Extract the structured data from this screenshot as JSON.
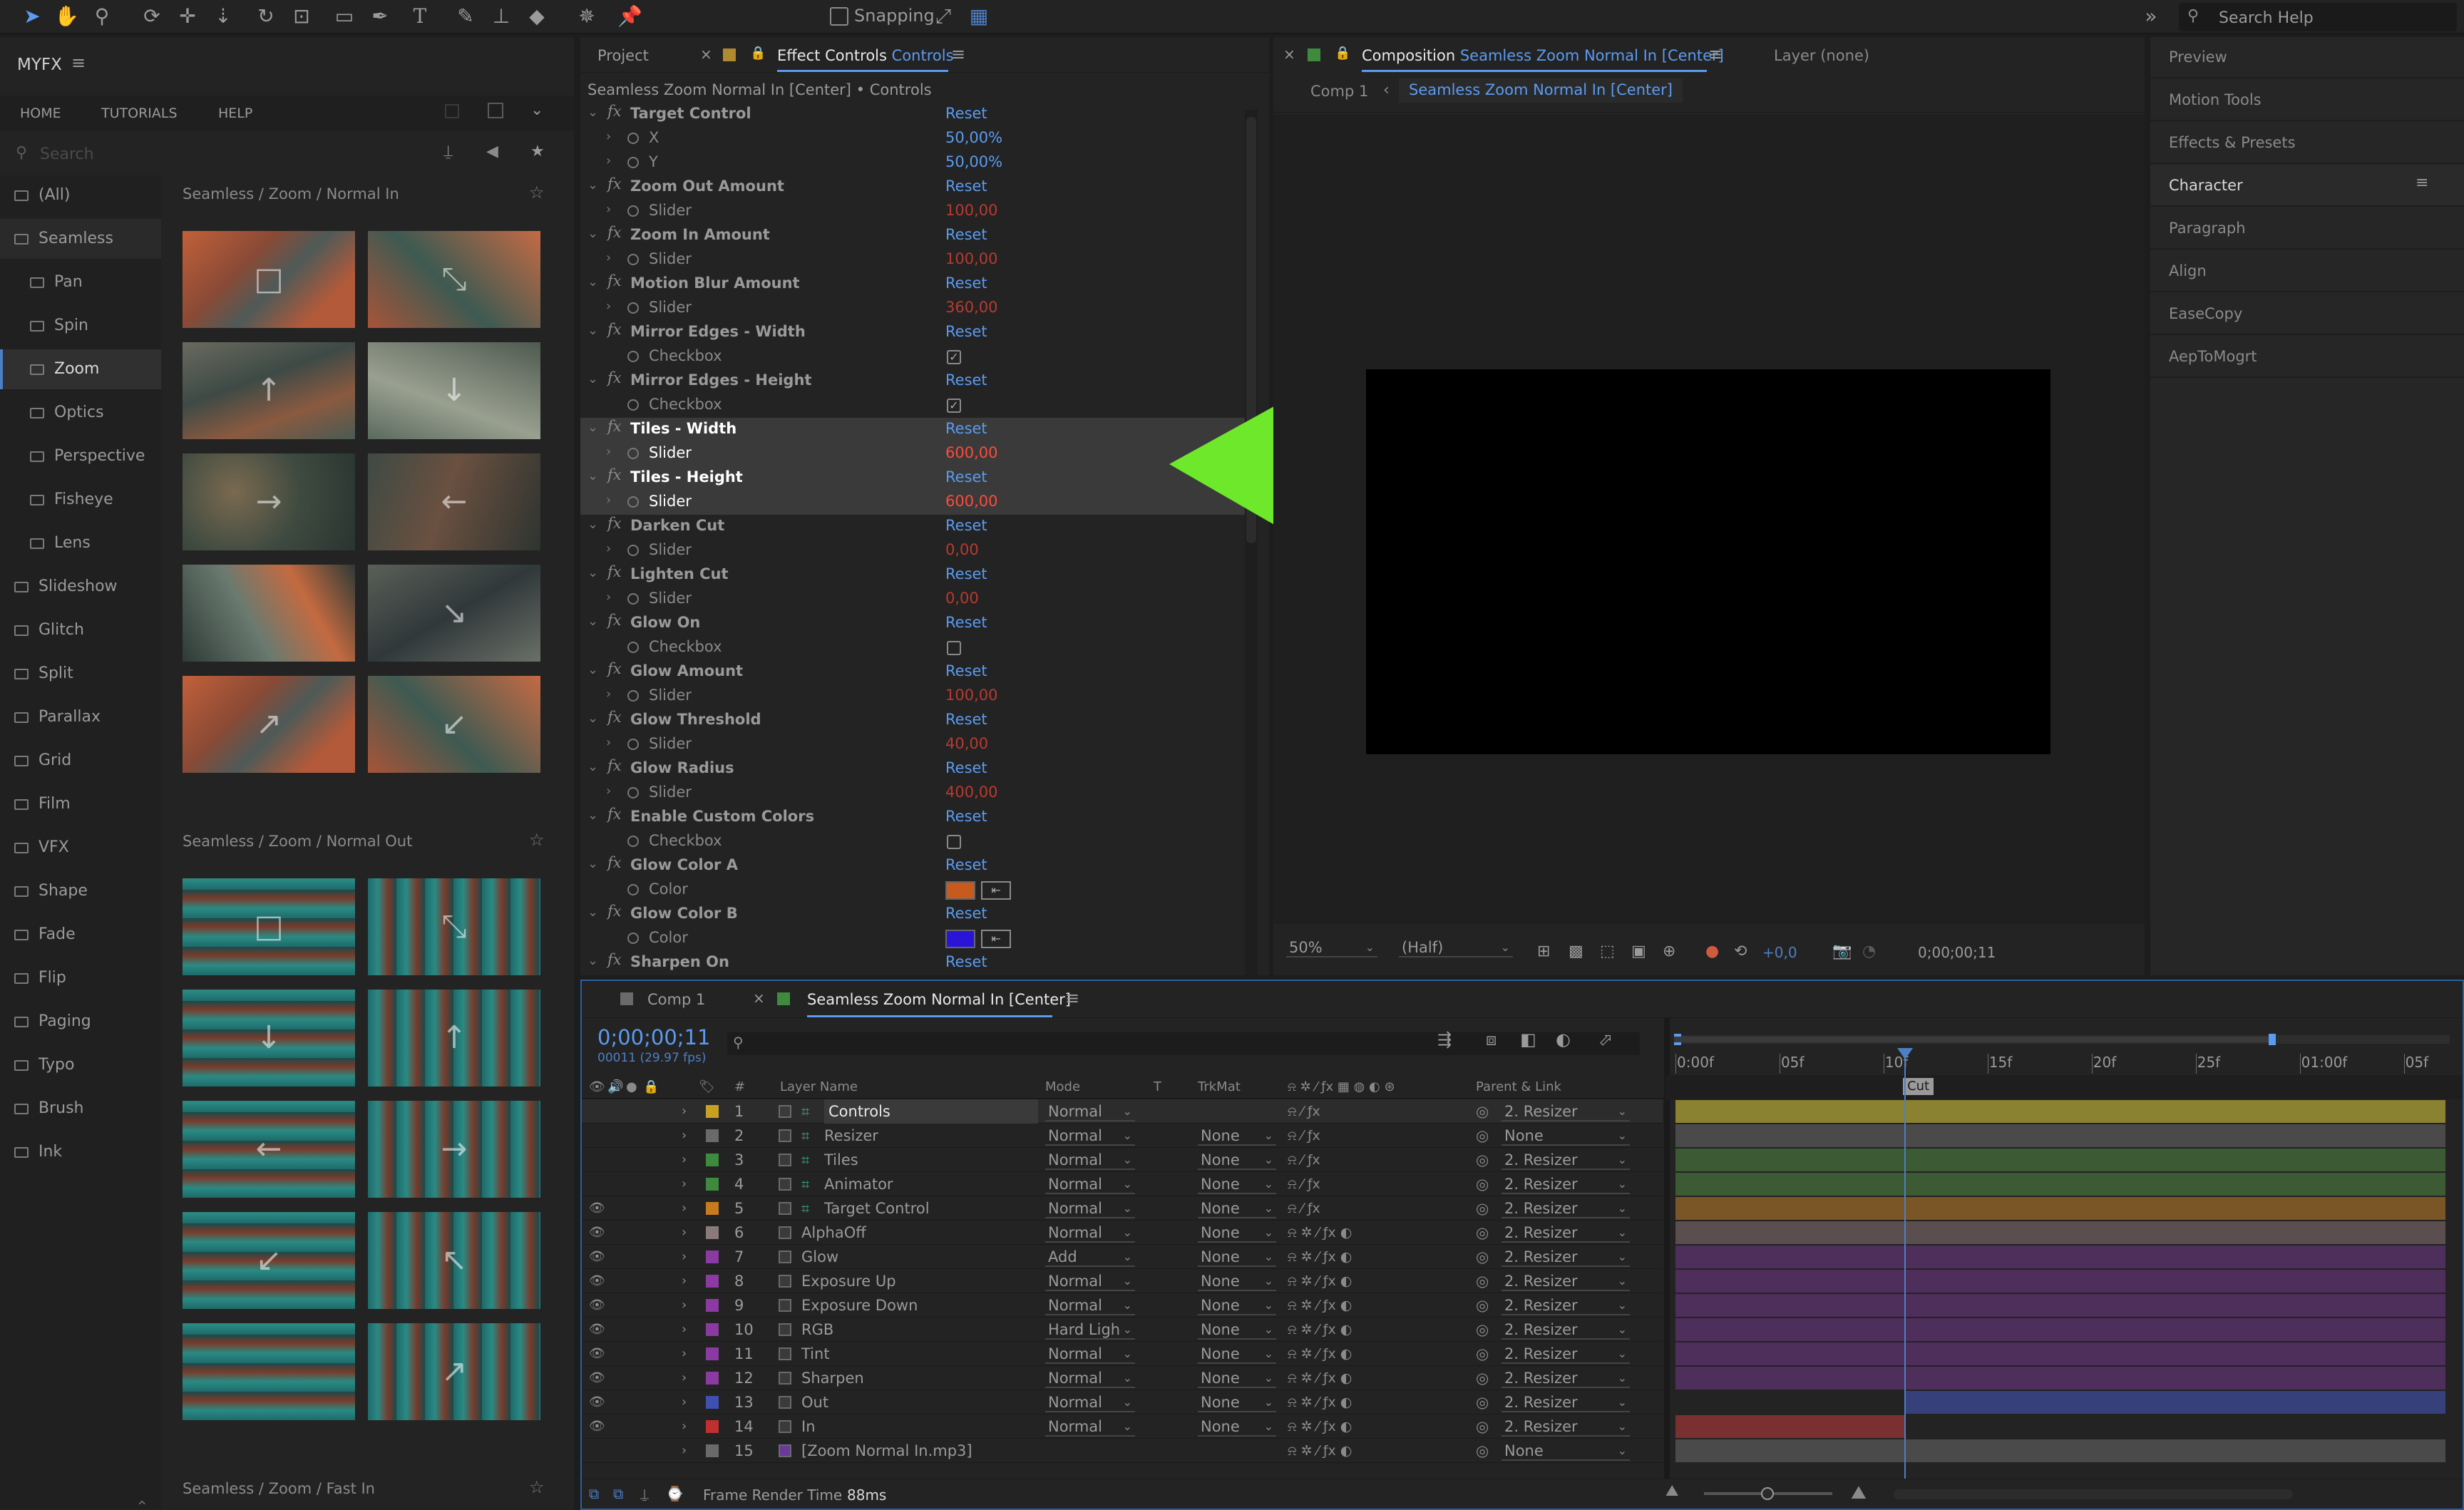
{
  "toolbar": {
    "snapping_label": "Snapping",
    "search_placeholder": "Search Help"
  },
  "myfx": {
    "title": "MYFX",
    "tabs": [
      "HOME",
      "TUTORIALS",
      "HELP"
    ],
    "search_placeholder": "Search",
    "categories": [
      {
        "label": "(All)",
        "indent": false,
        "active": false
      },
      {
        "label": "Seamless",
        "indent": false,
        "active": false,
        "expanded": true
      },
      {
        "label": "Pan",
        "indent": true,
        "active": false
      },
      {
        "label": "Spin",
        "indent": true,
        "active": false
      },
      {
        "label": "Zoom",
        "indent": true,
        "active": true
      },
      {
        "label": "Optics",
        "indent": true,
        "active": false
      },
      {
        "label": "Perspective",
        "indent": true,
        "active": false
      },
      {
        "label": "Fisheye",
        "indent": true,
        "active": false
      },
      {
        "label": "Lens",
        "indent": true,
        "active": false
      },
      {
        "label": "Slideshow",
        "indent": false,
        "active": false
      },
      {
        "label": "Glitch",
        "indent": false,
        "active": false
      },
      {
        "label": "Split",
        "indent": false,
        "active": false
      },
      {
        "label": "Parallax",
        "indent": false,
        "active": false
      },
      {
        "label": "Grid",
        "indent": false,
        "active": false
      },
      {
        "label": "Film",
        "indent": false,
        "active": false
      },
      {
        "label": "VFX",
        "indent": false,
        "active": false
      },
      {
        "label": "Shape",
        "indent": false,
        "active": false
      },
      {
        "label": "Fade",
        "indent": false,
        "active": false
      },
      {
        "label": "Flip",
        "indent": false,
        "active": false
      },
      {
        "label": "Paging",
        "indent": false,
        "active": false
      },
      {
        "label": "Typo",
        "indent": false,
        "active": false
      },
      {
        "label": "Brush",
        "indent": false,
        "active": false
      },
      {
        "label": "Ink",
        "indent": false,
        "active": false
      }
    ],
    "sections": [
      {
        "title": "Seamless / Zoom / Normal In",
        "style": "warm",
        "arrows": [
          "□",
          "⤡",
          "↑",
          "↓",
          "→",
          "←",
          "",
          "↘",
          "↗",
          "↙"
        ]
      },
      {
        "title": "Seamless / Zoom / Normal Out",
        "style": "teal",
        "arrows": [
          "□",
          "⤡",
          "↓",
          "↑",
          "←",
          "→",
          "↙",
          "↖",
          "",
          "↗"
        ]
      },
      {
        "title": "Seamless / Zoom / Fast In",
        "style": "warm",
        "arrows": []
      }
    ]
  },
  "effect_controls": {
    "tabs": {
      "project": "Project",
      "ec_prefix": "Effect Controls",
      "ec_name": "Controls"
    },
    "path": "Seamless Zoom Normal In [Center] • Controls",
    "reset_label": "Reset",
    "rows": [
      {
        "kind": "fx",
        "name": "Target Control",
        "hl": false
      },
      {
        "kind": "prop",
        "name": "X",
        "value": "50,00",
        "unit": "%",
        "vcolor": "blue",
        "hl": false
      },
      {
        "kind": "prop",
        "name": "Y",
        "value": "50,00",
        "unit": "%",
        "vcolor": "blue",
        "hl": false
      },
      {
        "kind": "fx",
        "name": "Zoom Out Amount",
        "hl": false
      },
      {
        "kind": "prop",
        "name": "Slider",
        "value": "100,00",
        "vcolor": "red",
        "hl": false
      },
      {
        "kind": "fx",
        "name": "Zoom In Amount",
        "hl": false
      },
      {
        "kind": "prop",
        "name": "Slider",
        "value": "100,00",
        "vcolor": "red",
        "hl": false
      },
      {
        "kind": "fx",
        "name": "Motion Blur Amount",
        "hl": false
      },
      {
        "kind": "prop",
        "name": "Slider",
        "value": "360,00",
        "vcolor": "red",
        "hl": false
      },
      {
        "kind": "fx",
        "name": "Mirror Edges - Width",
        "hl": false
      },
      {
        "kind": "check",
        "name": "Checkbox",
        "checked": true,
        "hl": false
      },
      {
        "kind": "fx",
        "name": "Mirror Edges - Height",
        "hl": false
      },
      {
        "kind": "check",
        "name": "Checkbox",
        "checked": true,
        "hl": false
      },
      {
        "kind": "fx",
        "name": "Tiles - Width",
        "hl": true
      },
      {
        "kind": "prop",
        "name": "Slider",
        "value": "600,00",
        "vcolor": "red",
        "hl": true
      },
      {
        "kind": "fx",
        "name": "Tiles - Height",
        "hl": true
      },
      {
        "kind": "prop",
        "name": "Slider",
        "value": "600,00",
        "vcolor": "red",
        "hl": true
      },
      {
        "kind": "fx",
        "name": "Darken Cut",
        "hl": false
      },
      {
        "kind": "prop",
        "name": "Slider",
        "value": "0,00",
        "vcolor": "red",
        "hl": false
      },
      {
        "kind": "fx",
        "name": "Lighten Cut",
        "hl": false
      },
      {
        "kind": "prop",
        "name": "Slider",
        "value": "0,00",
        "vcolor": "red",
        "hl": false
      },
      {
        "kind": "fx",
        "name": "Glow On",
        "hl": false
      },
      {
        "kind": "check",
        "name": "Checkbox",
        "checked": false,
        "hl": false
      },
      {
        "kind": "fx",
        "name": "Glow Amount",
        "hl": false
      },
      {
        "kind": "prop",
        "name": "Slider",
        "value": "100,00",
        "vcolor": "red",
        "hl": false
      },
      {
        "kind": "fx",
        "name": "Glow Threshold",
        "hl": false
      },
      {
        "kind": "prop",
        "name": "Slider",
        "value": "40,00",
        "vcolor": "red",
        "hl": false
      },
      {
        "kind": "fx",
        "name": "Glow Radius",
        "hl": false
      },
      {
        "kind": "prop",
        "name": "Slider",
        "value": "400,00",
        "vcolor": "red",
        "hl": false
      },
      {
        "kind": "fx",
        "name": "Enable Custom Colors",
        "hl": false
      },
      {
        "kind": "check",
        "name": "Checkbox",
        "checked": false,
        "hl": false
      },
      {
        "kind": "fx",
        "name": "Glow Color A",
        "hl": false
      },
      {
        "kind": "color",
        "name": "Color",
        "swatch": "#c85a1e",
        "hl": false
      },
      {
        "kind": "fx",
        "name": "Glow Color B",
        "hl": false
      },
      {
        "kind": "color",
        "name": "Color",
        "swatch": "#2a14d8",
        "hl": false
      },
      {
        "kind": "fx",
        "name": "Sharpen On",
        "hl": false
      }
    ]
  },
  "composition": {
    "tab_prefix": "Composition",
    "tab_name": "Seamless Zoom Normal In [Center]",
    "layer_tab": "Layer (none)",
    "breadcrumb_comp": "Comp 1",
    "breadcrumb_current": "Seamless Zoom Normal In [Center]",
    "zoom": "50%",
    "resolution": "(Half)",
    "exposure": "+0,0",
    "timecode": "0;00;00;11"
  },
  "right_panel": {
    "items": [
      "Preview",
      "Motion Tools",
      "Effects & Presets",
      "Character",
      "Paragraph",
      "Align",
      "EaseCopy",
      "AepToMogrt"
    ],
    "active": "Character"
  },
  "timeline": {
    "tabs": [
      "Comp 1",
      "Seamless Zoom Normal In [Center]"
    ],
    "timecode": "0;00;00;11",
    "fps": "00011 (29.97 fps)",
    "headers": {
      "num": "#",
      "layer_name": "Layer Name",
      "mode": "Mode",
      "t": "T",
      "trkmat": "TrkMat",
      "parent": "Parent & Link"
    },
    "ruler": [
      "0:00f",
      "05f",
      "10f",
      "15f",
      "20f",
      "25f",
      "01:00f",
      "05f"
    ],
    "marker": "Cut",
    "playhead_frame": 11,
    "total_frames": 37,
    "footer": {
      "label": "Frame Render Time",
      "value": "88ms"
    },
    "layers": [
      {
        "num": "1",
        "name": "Controls",
        "label_color": "#c8a024",
        "mode": "Normal",
        "trkmat": "",
        "parent": "2. Resizer",
        "eye": false,
        "solid": true,
        "selected": true,
        "bar": "#8a8230"
      },
      {
        "num": "2",
        "name": "Resizer",
        "label_color": "#6a6a6a",
        "mode": "Normal",
        "trkmat": "None",
        "parent": "None",
        "eye": false,
        "solid": true,
        "selected": false,
        "bar": "#4a4a4a"
      },
      {
        "num": "3",
        "name": "Tiles",
        "label_color": "#3e8a3e",
        "mode": "Normal",
        "trkmat": "None",
        "parent": "2. Resizer",
        "eye": false,
        "solid": true,
        "selected": false,
        "bar": "#3c5a34"
      },
      {
        "num": "4",
        "name": "Animator",
        "label_color": "#3e8a3e",
        "mode": "Normal",
        "trkmat": "None",
        "parent": "2. Resizer",
        "eye": false,
        "solid": true,
        "selected": false,
        "bar": "#3c5a34"
      },
      {
        "num": "5",
        "name": "Target Control",
        "label_color": "#c87a1e",
        "mode": "Normal",
        "trkmat": "None",
        "parent": "2. Resizer",
        "eye": true,
        "solid": true,
        "selected": false,
        "bar": "#7a5526"
      },
      {
        "num": "6",
        "name": "AlphaOff",
        "label_color": "#8a7a7a",
        "mode": "Normal",
        "trkmat": "None",
        "parent": "2. Resizer",
        "eye": true,
        "solid": false,
        "selected": false,
        "bar": "#5a4e4e"
      },
      {
        "num": "7",
        "name": "Glow",
        "label_color": "#8a3aa0",
        "mode": "Add",
        "trkmat": "None",
        "parent": "2. Resizer",
        "eye": true,
        "solid": false,
        "selected": false,
        "bar": "#4e2e5a"
      },
      {
        "num": "8",
        "name": "Exposure Up",
        "label_color": "#8a3aa0",
        "mode": "Normal",
        "trkmat": "None",
        "parent": "2. Resizer",
        "eye": true,
        "solid": false,
        "selected": false,
        "bar": "#4e2e5a"
      },
      {
        "num": "9",
        "name": "Exposure Down",
        "label_color": "#8a3aa0",
        "mode": "Normal",
        "trkmat": "None",
        "parent": "2. Resizer",
        "eye": true,
        "solid": false,
        "selected": false,
        "bar": "#4e2e5a"
      },
      {
        "num": "10",
        "name": "RGB",
        "label_color": "#8a3aa0",
        "mode": "Hard Ligh",
        "trkmat": "None",
        "parent": "2. Resizer",
        "eye": true,
        "solid": false,
        "selected": false,
        "bar": "#4e2e5a"
      },
      {
        "num": "11",
        "name": "Tint",
        "label_color": "#8a3aa0",
        "mode": "Normal",
        "trkmat": "None",
        "parent": "2. Resizer",
        "eye": true,
        "solid": false,
        "selected": false,
        "bar": "#4e2e5a"
      },
      {
        "num": "12",
        "name": "Sharpen",
        "label_color": "#8a3aa0",
        "mode": "Normal",
        "trkmat": "None",
        "parent": "2. Resizer",
        "eye": true,
        "solid": false,
        "selected": false,
        "bar": "#4e2e5a"
      },
      {
        "num": "13",
        "name": "Out",
        "label_color": "#4050b0",
        "mode": "Normal",
        "trkmat": "None",
        "parent": "2. Resizer",
        "eye": true,
        "solid": false,
        "selected": false,
        "bar": "#36407a",
        "bar_start": 11
      },
      {
        "num": "14",
        "name": "In",
        "label_color": "#c03030",
        "mode": "Normal",
        "trkmat": "None",
        "parent": "2. Resizer",
        "eye": true,
        "solid": false,
        "selected": false,
        "bar": "#7a3030",
        "bar_end": 11
      },
      {
        "num": "15",
        "name": "[Zoom Normal In.mp3]",
        "label_color": "#6a6a6a",
        "mode": "",
        "trkmat": "",
        "parent": "None",
        "eye": false,
        "solid": false,
        "selected": false,
        "bar": "#4a4a4a"
      }
    ]
  },
  "colors": {
    "accent_blue": "#5b9bf0",
    "value_red": "#e0443a",
    "arrow_green": "#6ee82a",
    "highlight": "#3a3a3a"
  }
}
